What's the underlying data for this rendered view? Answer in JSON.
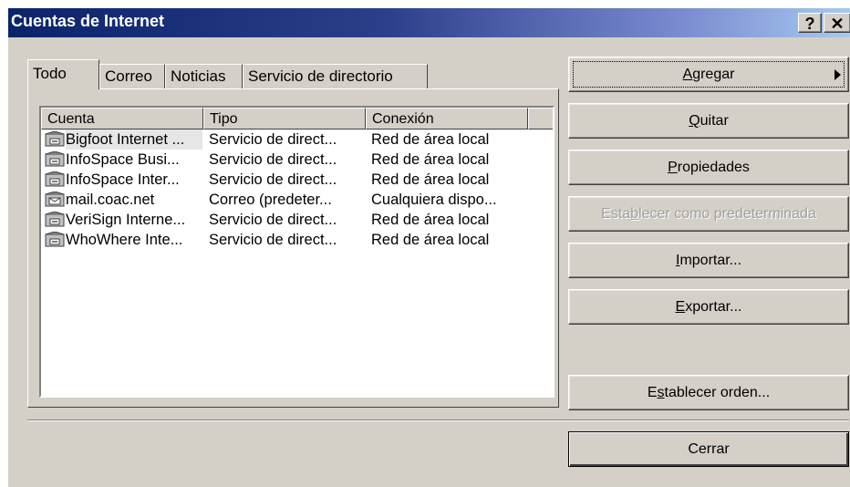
{
  "window": {
    "title": "Cuentas de Internet",
    "help_label": "?",
    "close_label": "✕"
  },
  "tabs": [
    {
      "label": "Todo"
    },
    {
      "label": "Correo"
    },
    {
      "label": "Noticias"
    },
    {
      "label": "Servicio de directorio"
    }
  ],
  "list": {
    "columns": [
      {
        "label": "Cuenta"
      },
      {
        "label": "Tipo"
      },
      {
        "label": "Conexión"
      }
    ],
    "rows": [
      {
        "account": "Bigfoot Internet ...",
        "type": "Servicio de direct...",
        "connection": "Red de área local",
        "icon": "directory-service-icon"
      },
      {
        "account": "InfoSpace Busi...",
        "type": "Servicio de direct...",
        "connection": "Red de área local",
        "icon": "directory-service-icon"
      },
      {
        "account": "InfoSpace Inter...",
        "type": "Servicio de direct...",
        "connection": "Red de área local",
        "icon": "directory-service-icon"
      },
      {
        "account": "mail.coac.net",
        "type": "Correo (predeter...",
        "connection": "Cualquiera dispo...",
        "icon": "mail-account-icon"
      },
      {
        "account": "VeriSign Interne...",
        "type": "Servicio de direct...",
        "connection": "Red de área local",
        "icon": "directory-service-icon"
      },
      {
        "account": "WhoWhere Inte...",
        "type": "Servicio de direct...",
        "connection": "Red de área local",
        "icon": "directory-service-icon"
      }
    ]
  },
  "buttons": {
    "add": {
      "label_pre": "",
      "accel": "A",
      "label_post": "gregar"
    },
    "remove": {
      "label_pre": "",
      "accel": "Q",
      "label_post": "uitar"
    },
    "properties": {
      "label_pre": "",
      "accel": "P",
      "label_post": "ropiedades"
    },
    "set_default": {
      "label_pre": "Esta",
      "accel": "b",
      "label_post": "lecer como predeterminada"
    },
    "import": {
      "label_pre": "",
      "accel": "I",
      "label_post": "mportar..."
    },
    "export": {
      "label_pre": "",
      "accel": "E",
      "label_post": "xportar..."
    },
    "set_order": {
      "label_pre": "E",
      "accel": "s",
      "label_post": "tablecer orden..."
    },
    "close": {
      "label": "Cerrar"
    }
  },
  "colors": {
    "title_start": "#0a246a",
    "title_end": "#a6caf0",
    "face": "#d4d0c8"
  }
}
